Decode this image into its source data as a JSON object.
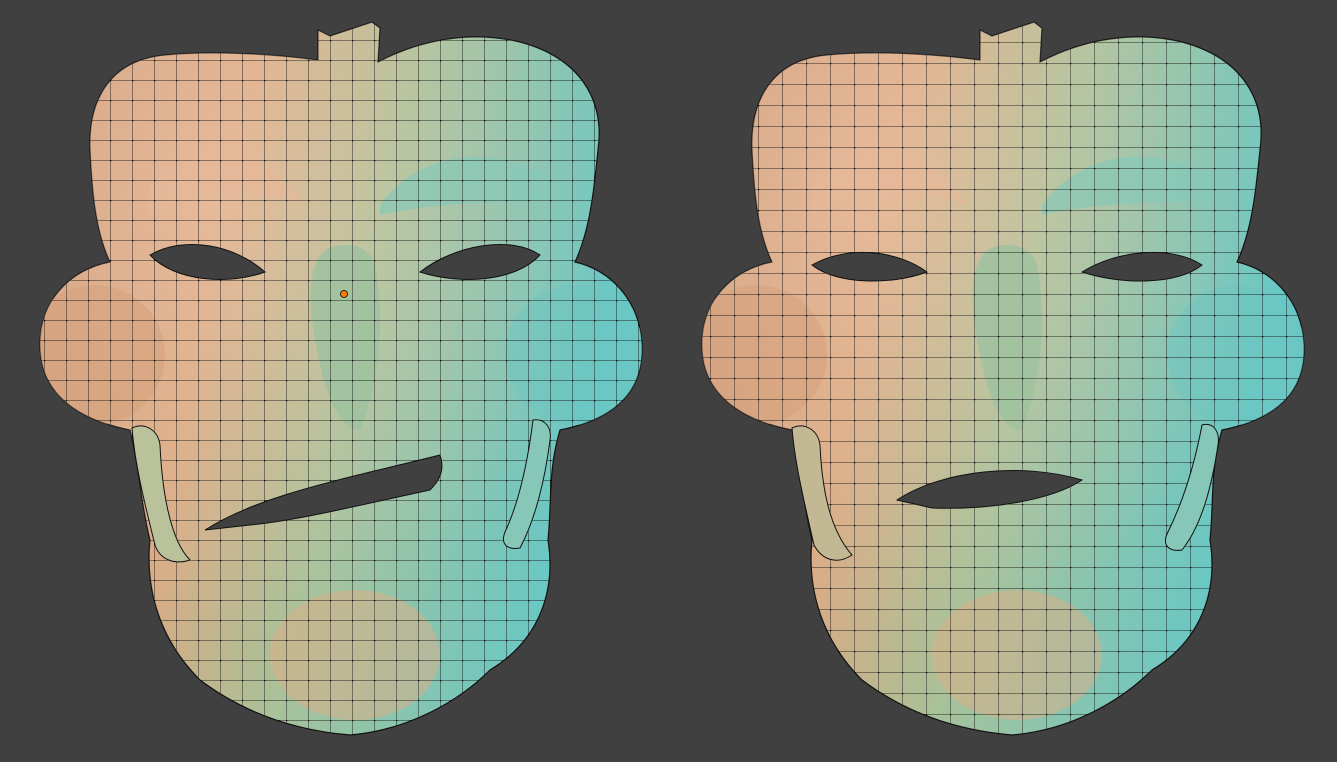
{
  "viewport": {
    "background": "#404040"
  },
  "shading": {
    "warm": "#d7a57f",
    "mid": "#a9c39a",
    "cool": "#6fc7c4",
    "highlight": "#f2c8b2",
    "wire": "#111111",
    "vertex": "#000000",
    "selected_vertex": "#ff7f00"
  },
  "models": [
    {
      "id": "mask-left",
      "wire_density": "dense",
      "has_selected_vertex": true
    },
    {
      "id": "mask-right",
      "wire_density": "dense",
      "has_selected_vertex": false
    }
  ]
}
